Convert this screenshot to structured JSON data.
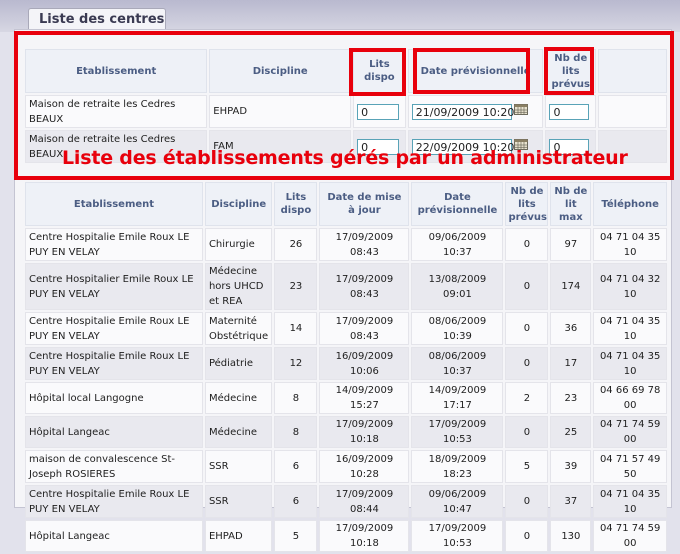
{
  "tab_title": "Liste des centres",
  "annotation": "Liste des établissements gérés par un administrateur",
  "colors": {
    "accent_red": "#e8000c",
    "header_text": "#4b5d83",
    "input_border": "#59a3b7"
  },
  "admin_table": {
    "headers": {
      "etablissement": "Etablissement",
      "discipline": "Discipline",
      "lits_dispo": "Lits dispo",
      "date_prev": "Date prévisionnelle",
      "nb_lits_prevus": "Nb de lits prévus"
    },
    "rows": [
      {
        "etablissement": "Maison de retraite les Cedres BEAUX",
        "discipline": "EHPAD",
        "lits_dispo": "0",
        "date_prev": "21/09/2009  10:20",
        "nb_lits_prevus": "0"
      },
      {
        "etablissement": "Maison de retraite les Cedres BEAUX",
        "discipline": "FAM",
        "lits_dispo": "0",
        "date_prev": "22/09/2009  10:20",
        "nb_lits_prevus": "0"
      }
    ]
  },
  "list_table": {
    "headers": {
      "etablissement": "Etablissement",
      "discipline": "Discipline",
      "lits_dispo": "Lits dispo",
      "date_maj": "Date de mise à jour",
      "date_prev": "Date prévisionnelle",
      "nb_lits_prevus": "Nb de lits prévus",
      "nb_lit_max": "Nb de lit max",
      "telephone": "Téléphone"
    },
    "rows": [
      {
        "etablissement": "Centre Hospitalie Emile Roux LE PUY EN VELAY",
        "discipline": "Chirurgie",
        "lits_dispo": "26",
        "date_maj": "17/09/2009 08:43",
        "date_prev": "09/06/2009 10:37",
        "nb_lits_prevus": "0",
        "nb_lit_max": "97",
        "telephone": "04 71 04 35 10"
      },
      {
        "etablissement": "Centre Hospitalier Emile Roux LE PUY EN VELAY",
        "discipline": "Médecine hors UHCD et REA",
        "lits_dispo": "23",
        "date_maj": "17/09/2009 08:43",
        "date_prev": "13/08/2009 09:01",
        "nb_lits_prevus": "0",
        "nb_lit_max": "174",
        "telephone": "04 71 04 32 10"
      },
      {
        "etablissement": "Centre Hospitalie Emile Roux LE PUY EN VELAY",
        "discipline": "Maternité Obstétrique",
        "lits_dispo": "14",
        "date_maj": "17/09/2009 08:43",
        "date_prev": "08/06/2009 10:39",
        "nb_lits_prevus": "0",
        "nb_lit_max": "36",
        "telephone": "04 71 04 35 10"
      },
      {
        "etablissement": "Centre Hospitalie Emile Roux LE PUY EN VELAY",
        "discipline": "Pédiatrie",
        "lits_dispo": "12",
        "date_maj": "16/09/2009 10:06",
        "date_prev": "08/06/2009 10:37",
        "nb_lits_prevus": "0",
        "nb_lit_max": "17",
        "telephone": "04 71 04 35 10"
      },
      {
        "etablissement": "Hôpital local Langogne",
        "discipline": "Médecine",
        "lits_dispo": "8",
        "date_maj": "14/09/2009 15:27",
        "date_prev": "14/09/2009 17:17",
        "nb_lits_prevus": "2",
        "nb_lit_max": "23",
        "telephone": "04 66 69 78 00"
      },
      {
        "etablissement": "Hôpital Langeac",
        "discipline": "Médecine",
        "lits_dispo": "8",
        "date_maj": "17/09/2009 10:18",
        "date_prev": "17/09/2009 10:53",
        "nb_lits_prevus": "0",
        "nb_lit_max": "25",
        "telephone": "04 71 74 59 00"
      },
      {
        "etablissement": "maison de convalescence St-Joseph ROSIERES",
        "discipline": "SSR",
        "lits_dispo": "6",
        "date_maj": "16/09/2009 10:28",
        "date_prev": "18/09/2009 18:23",
        "nb_lits_prevus": "5",
        "nb_lit_max": "39",
        "telephone": "04 71 57 49 50"
      },
      {
        "etablissement": "Centre Hospitalie Emile Roux LE PUY EN VELAY",
        "discipline": "SSR",
        "lits_dispo": "6",
        "date_maj": "17/09/2009 08:44",
        "date_prev": "09/06/2009 10:47",
        "nb_lits_prevus": "0",
        "nb_lit_max": "37",
        "telephone": "04 71 04 35 10"
      },
      {
        "etablissement": "Hôpital Langeac",
        "discipline": "EHPAD",
        "lits_dispo": "5",
        "date_maj": "17/09/2009 10:18",
        "date_prev": "17/09/2009 10:53",
        "nb_lits_prevus": "0",
        "nb_lit_max": "130",
        "telephone": "04 71 74 59 00"
      }
    ]
  }
}
